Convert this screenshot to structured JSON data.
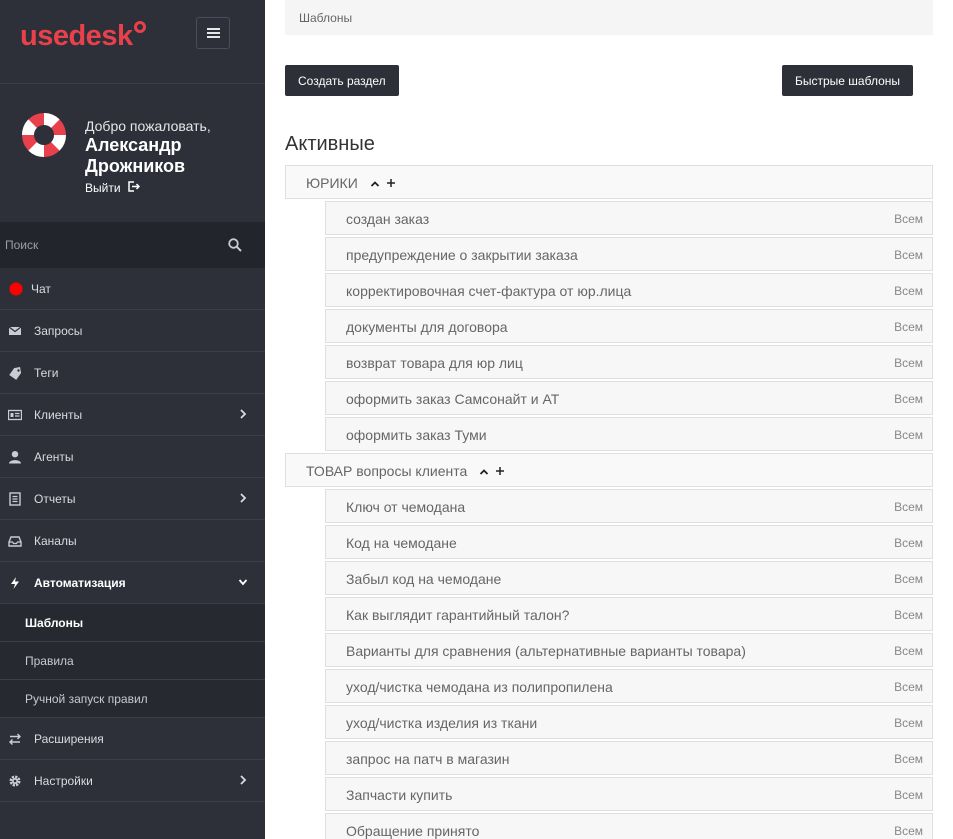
{
  "app": {
    "logo_text": "usedesk"
  },
  "sidebar": {
    "welcome": "Добро пожаловать,",
    "user_name": "Александр Дрожников",
    "logout": "Выйти",
    "search_placeholder": "Поиск",
    "items": [
      {
        "label": "Чат",
        "icon": "status-dot-icon"
      },
      {
        "label": "Запросы",
        "icon": "envelope-icon"
      },
      {
        "label": "Теги",
        "icon": "tag-icon"
      },
      {
        "label": "Клиенты",
        "icon": "id-card-icon",
        "chevron": "right"
      },
      {
        "label": "Агенты",
        "icon": "user-icon"
      },
      {
        "label": "Отчеты",
        "icon": "report-icon",
        "chevron": "right"
      },
      {
        "label": "Каналы",
        "icon": "inbox-icon"
      },
      {
        "label": "Автоматизация",
        "icon": "lightning-icon",
        "chevron": "down"
      }
    ],
    "subitems": [
      {
        "label": "Шаблоны"
      },
      {
        "label": "Правила"
      },
      {
        "label": "Ручной запуск правил"
      }
    ],
    "items_after": [
      {
        "label": "Расширения",
        "icon": "exchange-icon"
      },
      {
        "label": "Настройки",
        "icon": "gear-icon",
        "chevron": "right"
      }
    ],
    "colors": {
      "bg": "#2d3039",
      "accent": "#e8414b",
      "chat_status": "#ff0000"
    }
  },
  "main": {
    "breadcrumb": "Шаблоны",
    "create_button": "Создать раздел",
    "quick_button": "Быстрые шаблоны",
    "section_title": "Активные",
    "groups": [
      {
        "name": "ЮРИКИ",
        "templates": [
          {
            "name": "создан заказ",
            "scope": "Всем"
          },
          {
            "name": "предупреждение о закрытии заказа",
            "scope": "Всем"
          },
          {
            "name": "корректировочная счет-фактура от юр.лица",
            "scope": "Всем"
          },
          {
            "name": "документы для договора",
            "scope": "Всем"
          },
          {
            "name": "возврат товара для юр лиц",
            "scope": "Всем"
          },
          {
            "name": "оформить заказ Самсонайт и AT",
            "scope": "Всем"
          },
          {
            "name": "оформить заказ Туми",
            "scope": "Всем"
          }
        ]
      },
      {
        "name": "ТОВАР вопросы клиента",
        "templates": [
          {
            "name": "Ключ от чемодана",
            "scope": "Всем"
          },
          {
            "name": "Код на чемодане",
            "scope": "Всем"
          },
          {
            "name": "Забыл код на чемодане",
            "scope": "Всем"
          },
          {
            "name": "Как выглядит гарантийный талон?",
            "scope": "Всем"
          },
          {
            "name": "Варианты для сравнения (альтернативные варианты товара)",
            "scope": "Всем"
          },
          {
            "name": "уход/чистка чемодана из полипропилена",
            "scope": "Всем"
          },
          {
            "name": "уход/чистка изделия из ткани",
            "scope": "Всем"
          },
          {
            "name": "запрос на патч в магазин",
            "scope": "Всем"
          },
          {
            "name": "Запчасти купить",
            "scope": "Всем"
          },
          {
            "name": "Обращение принято",
            "scope": "Всем"
          }
        ]
      }
    ]
  }
}
